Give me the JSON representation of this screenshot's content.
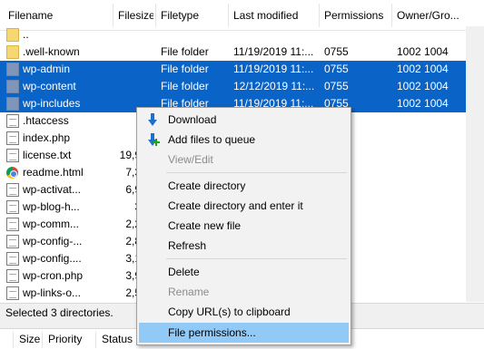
{
  "columns": {
    "filename": "Filename",
    "filesize": "Filesize",
    "filetype": "Filetype",
    "last_modified": "Last modified",
    "permissions": "Permissions",
    "owner_group": "Owner/Gro..."
  },
  "rows": [
    {
      "name": "..",
      "size": "",
      "type": "",
      "modified": "",
      "perm": "",
      "owner": "",
      "icon": "folder-icon",
      "selected": false
    },
    {
      "name": ".well-known",
      "size": "",
      "type": "File folder",
      "modified": "11/19/2019 11:...",
      "perm": "0755",
      "owner": "1002 1004",
      "icon": "folder-icon",
      "selected": false
    },
    {
      "name": "wp-admin",
      "size": "",
      "type": "File folder",
      "modified": "11/19/2019 11:...",
      "perm": "0755",
      "owner": "1002 1004",
      "icon": "folder-icon",
      "selected": true
    },
    {
      "name": "wp-content",
      "size": "",
      "type": "File folder",
      "modified": "12/12/2019 11:...",
      "perm": "0755",
      "owner": "1002 1004",
      "icon": "folder-icon",
      "selected": true
    },
    {
      "name": "wp-includes",
      "size": "",
      "type": "File folder",
      "modified": "11/19/2019 11:...",
      "perm": "0755",
      "owner": "1002 1004",
      "icon": "folder-icon",
      "selected": true
    },
    {
      "name": ".htaccess",
      "size": "",
      "type": "",
      "modified": "",
      "perm": "",
      "owner": "",
      "icon": "file-icon",
      "selected": false
    },
    {
      "name": "index.php",
      "size": "",
      "type": "",
      "modified": "",
      "perm": "",
      "owner": "",
      "icon": "file-icon",
      "selected": false
    },
    {
      "name": "license.txt",
      "size": "19,9",
      "type": "",
      "modified": "",
      "perm": "",
      "owner": "",
      "icon": "file-icon",
      "selected": false
    },
    {
      "name": "readme.html",
      "size": "7,3",
      "type": "",
      "modified": "",
      "perm": "",
      "owner": "",
      "icon": "chrome-icon",
      "selected": false
    },
    {
      "name": "wp-activat...",
      "size": "6,9",
      "type": "",
      "modified": "",
      "perm": "",
      "owner": "",
      "icon": "file-icon",
      "selected": false
    },
    {
      "name": "wp-blog-h...",
      "size": "3",
      "type": "",
      "modified": "",
      "perm": "",
      "owner": "",
      "icon": "file-icon",
      "selected": false
    },
    {
      "name": "wp-comm...",
      "size": "2,2",
      "type": "",
      "modified": "",
      "perm": "",
      "owner": "",
      "icon": "file-icon",
      "selected": false
    },
    {
      "name": "wp-config-...",
      "size": "2,8",
      "type": "",
      "modified": "",
      "perm": "",
      "owner": "",
      "icon": "file-icon",
      "selected": false
    },
    {
      "name": "wp-config....",
      "size": "3,1",
      "type": "",
      "modified": "",
      "perm": "",
      "owner": "",
      "icon": "file-icon",
      "selected": false
    },
    {
      "name": "wp-cron.php",
      "size": "3,9",
      "type": "",
      "modified": "",
      "perm": "",
      "owner": "",
      "icon": "file-icon",
      "selected": false
    },
    {
      "name": "wp-links-o...",
      "size": "2,5",
      "type": "",
      "modified": "",
      "perm": "",
      "owner": "",
      "icon": "file-icon",
      "selected": false
    }
  ],
  "status": "Selected 3 directories.",
  "queue_columns": {
    "size": "Size",
    "priority": "Priority",
    "status": "Status"
  },
  "context_menu": {
    "download": "Download",
    "add_to_queue": "Add files to queue",
    "view_edit": "View/Edit",
    "create_directory": "Create directory",
    "create_directory_enter": "Create directory and enter it",
    "create_new_file": "Create new file",
    "refresh": "Refresh",
    "delete": "Delete",
    "rename": "Rename",
    "copy_url": "Copy URL(s) to clipboard",
    "file_permissions": "File permissions..."
  },
  "colors": {
    "selection": "#0a64c8",
    "menu_hover": "#91c9f7",
    "folder": "#f7d774"
  }
}
